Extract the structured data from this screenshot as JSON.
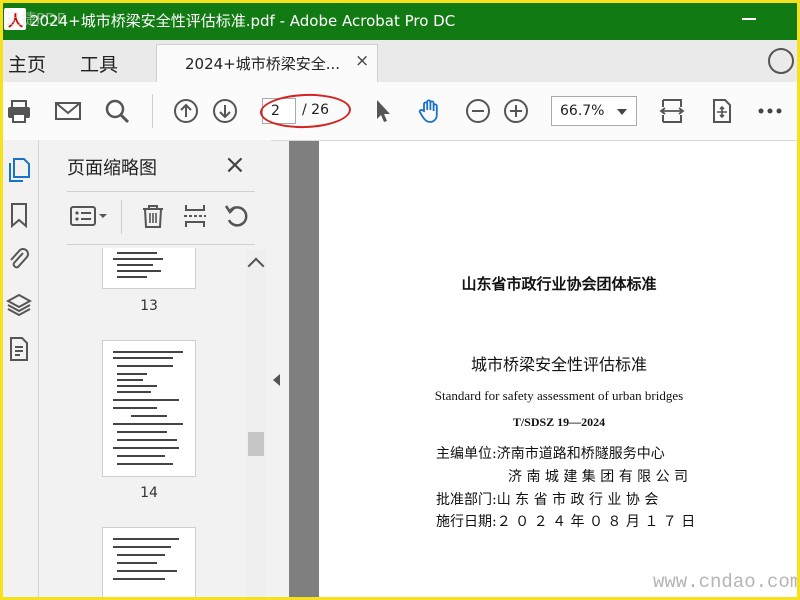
{
  "window": {
    "title": "2024+城市桥梁安全性评估标准.pdf - Adobe Acrobat Pro DC",
    "watermark_tl": "迅捷PDF"
  },
  "tabs": {
    "home": "主页",
    "tools": "工具",
    "document_tab": "2024+城市桥梁安全...",
    "close": "×"
  },
  "toolbar": {
    "page_current": "2",
    "page_total": "/ 26",
    "zoom": "66.7%",
    "icons": [
      "print-icon",
      "email-icon",
      "search-icon",
      "page-up-icon",
      "page-down-icon",
      "select-arrow-icon",
      "hand-icon",
      "zoom-out-icon",
      "zoom-in-icon",
      "fit-width-icon",
      "rotate-view-icon",
      "more-icon"
    ]
  },
  "rail": {
    "icons": [
      "page-thumbnails-icon",
      "bookmark-icon",
      "attachment-icon",
      "layers-icon",
      "document-properties-icon"
    ]
  },
  "thumbnails_panel": {
    "title": "页面缩略图",
    "close": "×",
    "pages": [
      {
        "label": "13"
      },
      {
        "label": "14"
      },
      {
        "label": ""
      }
    ]
  },
  "document": {
    "org_title": "山东省市政行业协会团体标准",
    "standard_name": "城市桥梁安全性评估标准",
    "english_name": "Standard for safety assessment of urban bridges",
    "code": "T/SDSZ 19—2024",
    "rows": [
      {
        "label": "主编单位:",
        "value": "济南市道路和桥隧服务中心"
      },
      {
        "label": "",
        "value": "济 南 城 建 集 团 有 限 公 司"
      },
      {
        "label": "批准部门:",
        "value": "山 东 省 市 政 行 业 协 会"
      },
      {
        "label": "施行日期:",
        "value": "２ ０ ２ ４ 年 ０ ８ 月 １ ７ 日"
      }
    ]
  },
  "watermark": "www.cndao.com",
  "colors": {
    "titlebar": "#127a12",
    "annotation": "#d5231f",
    "hand_tool": "#1a73c8"
  }
}
